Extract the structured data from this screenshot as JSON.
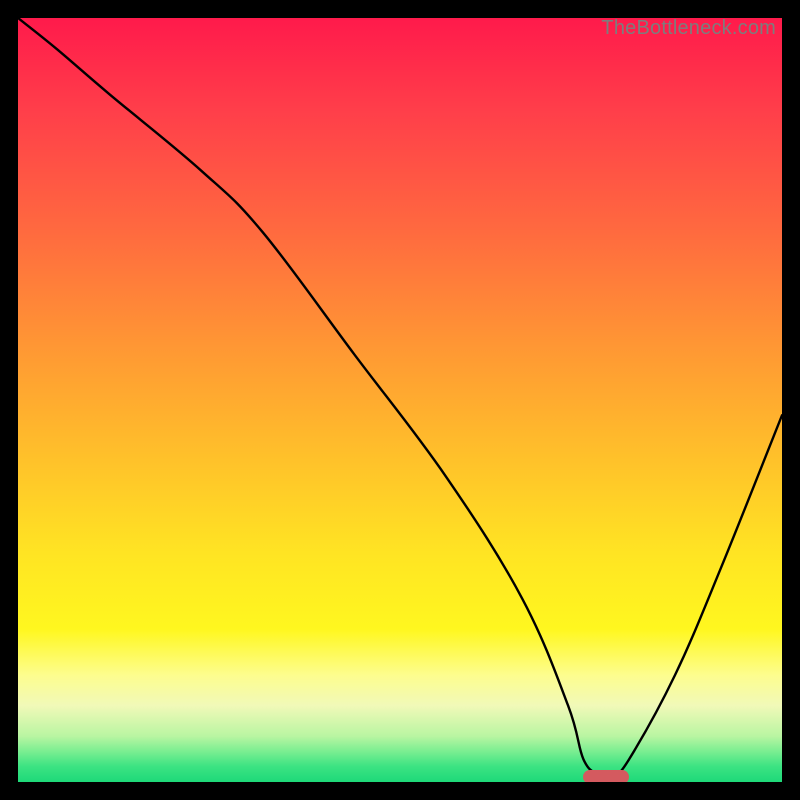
{
  "watermark": "TheBottleneck.com",
  "chart_data": {
    "type": "line",
    "title": "",
    "xlabel": "",
    "ylabel": "",
    "xlim": [
      0,
      100
    ],
    "ylim": [
      0,
      100
    ],
    "legend": false,
    "grid": false,
    "series": [
      {
        "name": "bottleneck-curve",
        "x": [
          0,
          5,
          12,
          24,
          32,
          44,
          56,
          66,
          72,
          74,
          76,
          78,
          80,
          86,
          92,
          100
        ],
        "values": [
          100,
          96,
          90,
          80,
          72,
          56,
          40,
          24,
          10,
          3,
          1,
          1,
          3,
          14,
          28,
          48
        ]
      }
    ],
    "annotations": [
      {
        "name": "optimal-marker",
        "x": 77,
        "y": 0.6
      }
    ],
    "background_gradient": {
      "stops": [
        {
          "pos": 0,
          "color": "#ff1a4b"
        },
        {
          "pos": 50,
          "color": "#ffc22a"
        },
        {
          "pos": 85,
          "color": "#fff71f"
        },
        {
          "pos": 100,
          "color": "#1ed979"
        }
      ]
    }
  }
}
